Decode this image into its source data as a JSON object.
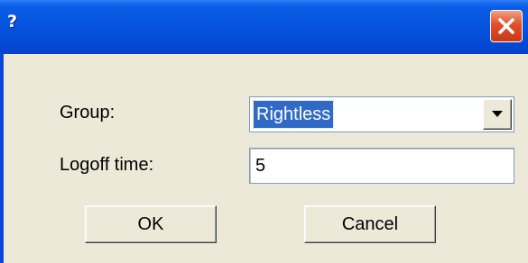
{
  "window": {
    "title": "?",
    "close_icon": "close-icon"
  },
  "form": {
    "group_label": "Group:",
    "group_value": "Rightless",
    "logoff_label": "Logoff time:",
    "logoff_value": "5"
  },
  "buttons": {
    "ok_label": "OK",
    "cancel_label": "Cancel"
  },
  "colors": {
    "titlebar": "#0654df",
    "close_button": "#e0502a",
    "client_background": "#ece9d8",
    "selection": "#316ac5"
  }
}
